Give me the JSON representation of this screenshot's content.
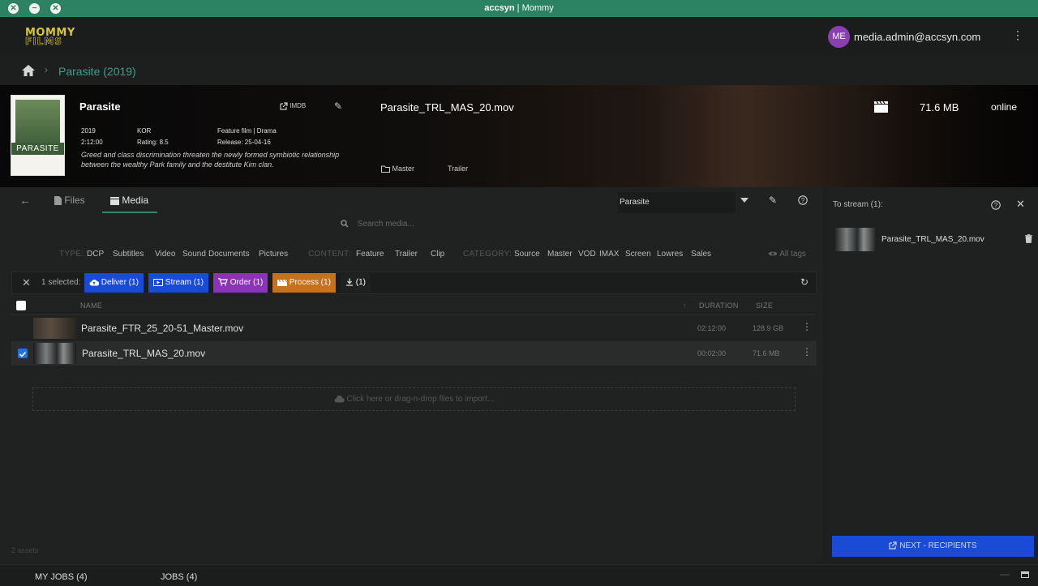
{
  "window": {
    "brand": "accsyn",
    "title": "| Mommy"
  },
  "logo": {
    "line1": "MOMMY",
    "line2": "FILMS"
  },
  "user": {
    "initials": "ME",
    "email": "media.admin@accsyn.com"
  },
  "breadcrumb": {
    "current": "Parasite (2019)"
  },
  "title_info": {
    "title": "Parasite",
    "imdb_label": "IMDB",
    "year": "2019",
    "country": "KOR",
    "genre": "Feature film | Drama",
    "runtime": "2:12:00",
    "rating": "Rating: 8.5",
    "release": "Release: 25-04-16",
    "description": "Greed and class discrimination threaten the newly formed symbiotic relationship between the wealthy Park family and the destitute Kim clan.",
    "poster_text": "PARASITE"
  },
  "preview": {
    "filename": "Parasite_TRL_MAS_20.mov",
    "size": "71.6 MB",
    "status": "online",
    "tag_master": "Master",
    "tag_trailer": "Trailer"
  },
  "tabs": {
    "files": "Files",
    "media": "Media"
  },
  "project_select": {
    "value": "Parasite"
  },
  "search": {
    "placeholder": "Search media..."
  },
  "filters": {
    "type_label": "TYPE:",
    "type": [
      "DCP",
      "Subtitles",
      "Video",
      "Sound",
      "Documents",
      "Pictures"
    ],
    "content_label": "CONTENT:",
    "content": [
      "Feature",
      "Trailer",
      "Clip"
    ],
    "category_label": "CATEGORY:",
    "category": [
      "Source",
      "Master",
      "VOD",
      "IMAX",
      "Screen",
      "Lowres",
      "Sales"
    ],
    "all_tags": "All tags"
  },
  "actions": {
    "selected": "1 selected:",
    "deliver": "Deliver (1)",
    "stream": "Stream (1)",
    "order": "Order (1)",
    "process": "Process (1)",
    "download": "(1)"
  },
  "table": {
    "headers": {
      "name": "NAME",
      "duration": "DURATION",
      "size": "SIZE"
    },
    "rows": [
      {
        "name": "Parasite_FTR_25_20-51_Master.mov",
        "duration": "02:12:00",
        "size": "128.9 GB",
        "selected": false
      },
      {
        "name": "Parasite_TRL_MAS_20.mov",
        "duration": "00:02:00",
        "size": "71.6 MB",
        "selected": true
      }
    ]
  },
  "dropzone": {
    "text": "Click here or drag-n-drop files to import..."
  },
  "footer": {
    "assets": "2 assets"
  },
  "side": {
    "header": "To stream (1):",
    "item": "Parasite_TRL_MAS_20.mov",
    "next": "NEXT - RECIPIENTS"
  },
  "bottom": {
    "my_jobs": "MY JOBS (4)",
    "jobs": "JOBS (4)"
  },
  "colors": {
    "accent": "#2c8363",
    "deliver": "#1a4bd6",
    "order": "#8a35b8",
    "process": "#c8701a"
  }
}
